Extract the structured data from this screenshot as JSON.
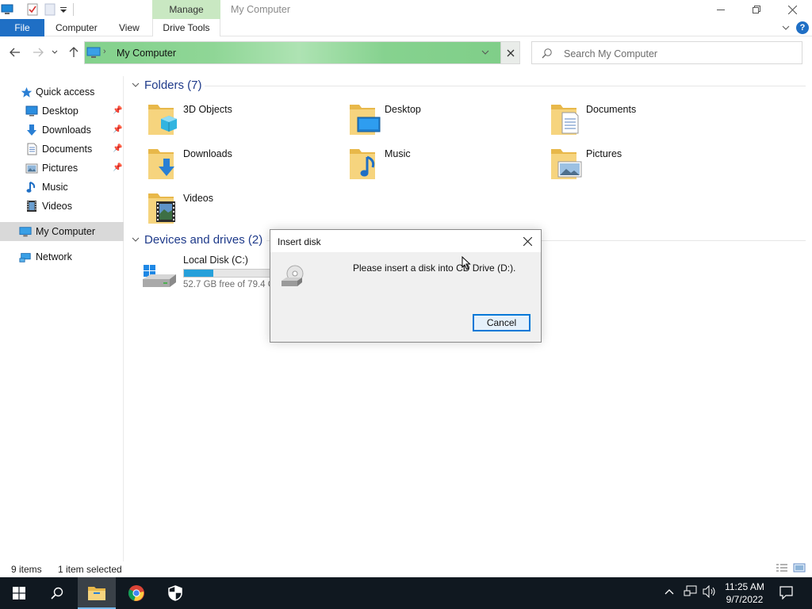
{
  "window": {
    "title": "My Computer",
    "context_tab": "Manage"
  },
  "ribbon": {
    "tabs": [
      "File",
      "Computer",
      "View",
      "Drive Tools"
    ]
  },
  "address": {
    "path": "My Computer",
    "search_placeholder": "Search My Computer"
  },
  "sidebar": {
    "items": [
      {
        "label": "Quick access",
        "icon": "star-icon"
      },
      {
        "label": "Desktop",
        "icon": "desktop-icon",
        "pinned": true
      },
      {
        "label": "Downloads",
        "icon": "download-icon",
        "pinned": true
      },
      {
        "label": "Documents",
        "icon": "document-icon",
        "pinned": true
      },
      {
        "label": "Pictures",
        "icon": "pictures-icon",
        "pinned": true
      },
      {
        "label": "Music",
        "icon": "music-icon"
      },
      {
        "label": "Videos",
        "icon": "videos-icon"
      },
      {
        "label": "My Computer",
        "icon": "computer-icon",
        "selected": true
      },
      {
        "label": "Network",
        "icon": "network-icon"
      }
    ]
  },
  "folders_group": {
    "header": "Folders (7)",
    "items": [
      {
        "name": "3D Objects"
      },
      {
        "name": "Desktop"
      },
      {
        "name": "Documents"
      },
      {
        "name": "Downloads"
      },
      {
        "name": "Music"
      },
      {
        "name": "Pictures"
      },
      {
        "name": "Videos"
      }
    ]
  },
  "drives_group": {
    "header": "Devices and drives (2)",
    "items": [
      {
        "name": "Local Disk (C:)",
        "free_text": "52.7 GB free of 79.4 GB",
        "used_fraction": 0.34
      }
    ]
  },
  "status": {
    "items_count": "9 items",
    "selection": "1 item selected"
  },
  "dialog": {
    "title": "Insert disk",
    "message": "Please insert a disk into CD Drive (D:).",
    "cancel_label": "Cancel"
  },
  "taskbar": {
    "time": "11:25 AM",
    "date": "9/7/2022"
  },
  "colors": {
    "accent": "#1f6fc5",
    "address_highlight": "#83d18c",
    "context_tab": "#c9e8c2",
    "taskbar": "#101820"
  }
}
